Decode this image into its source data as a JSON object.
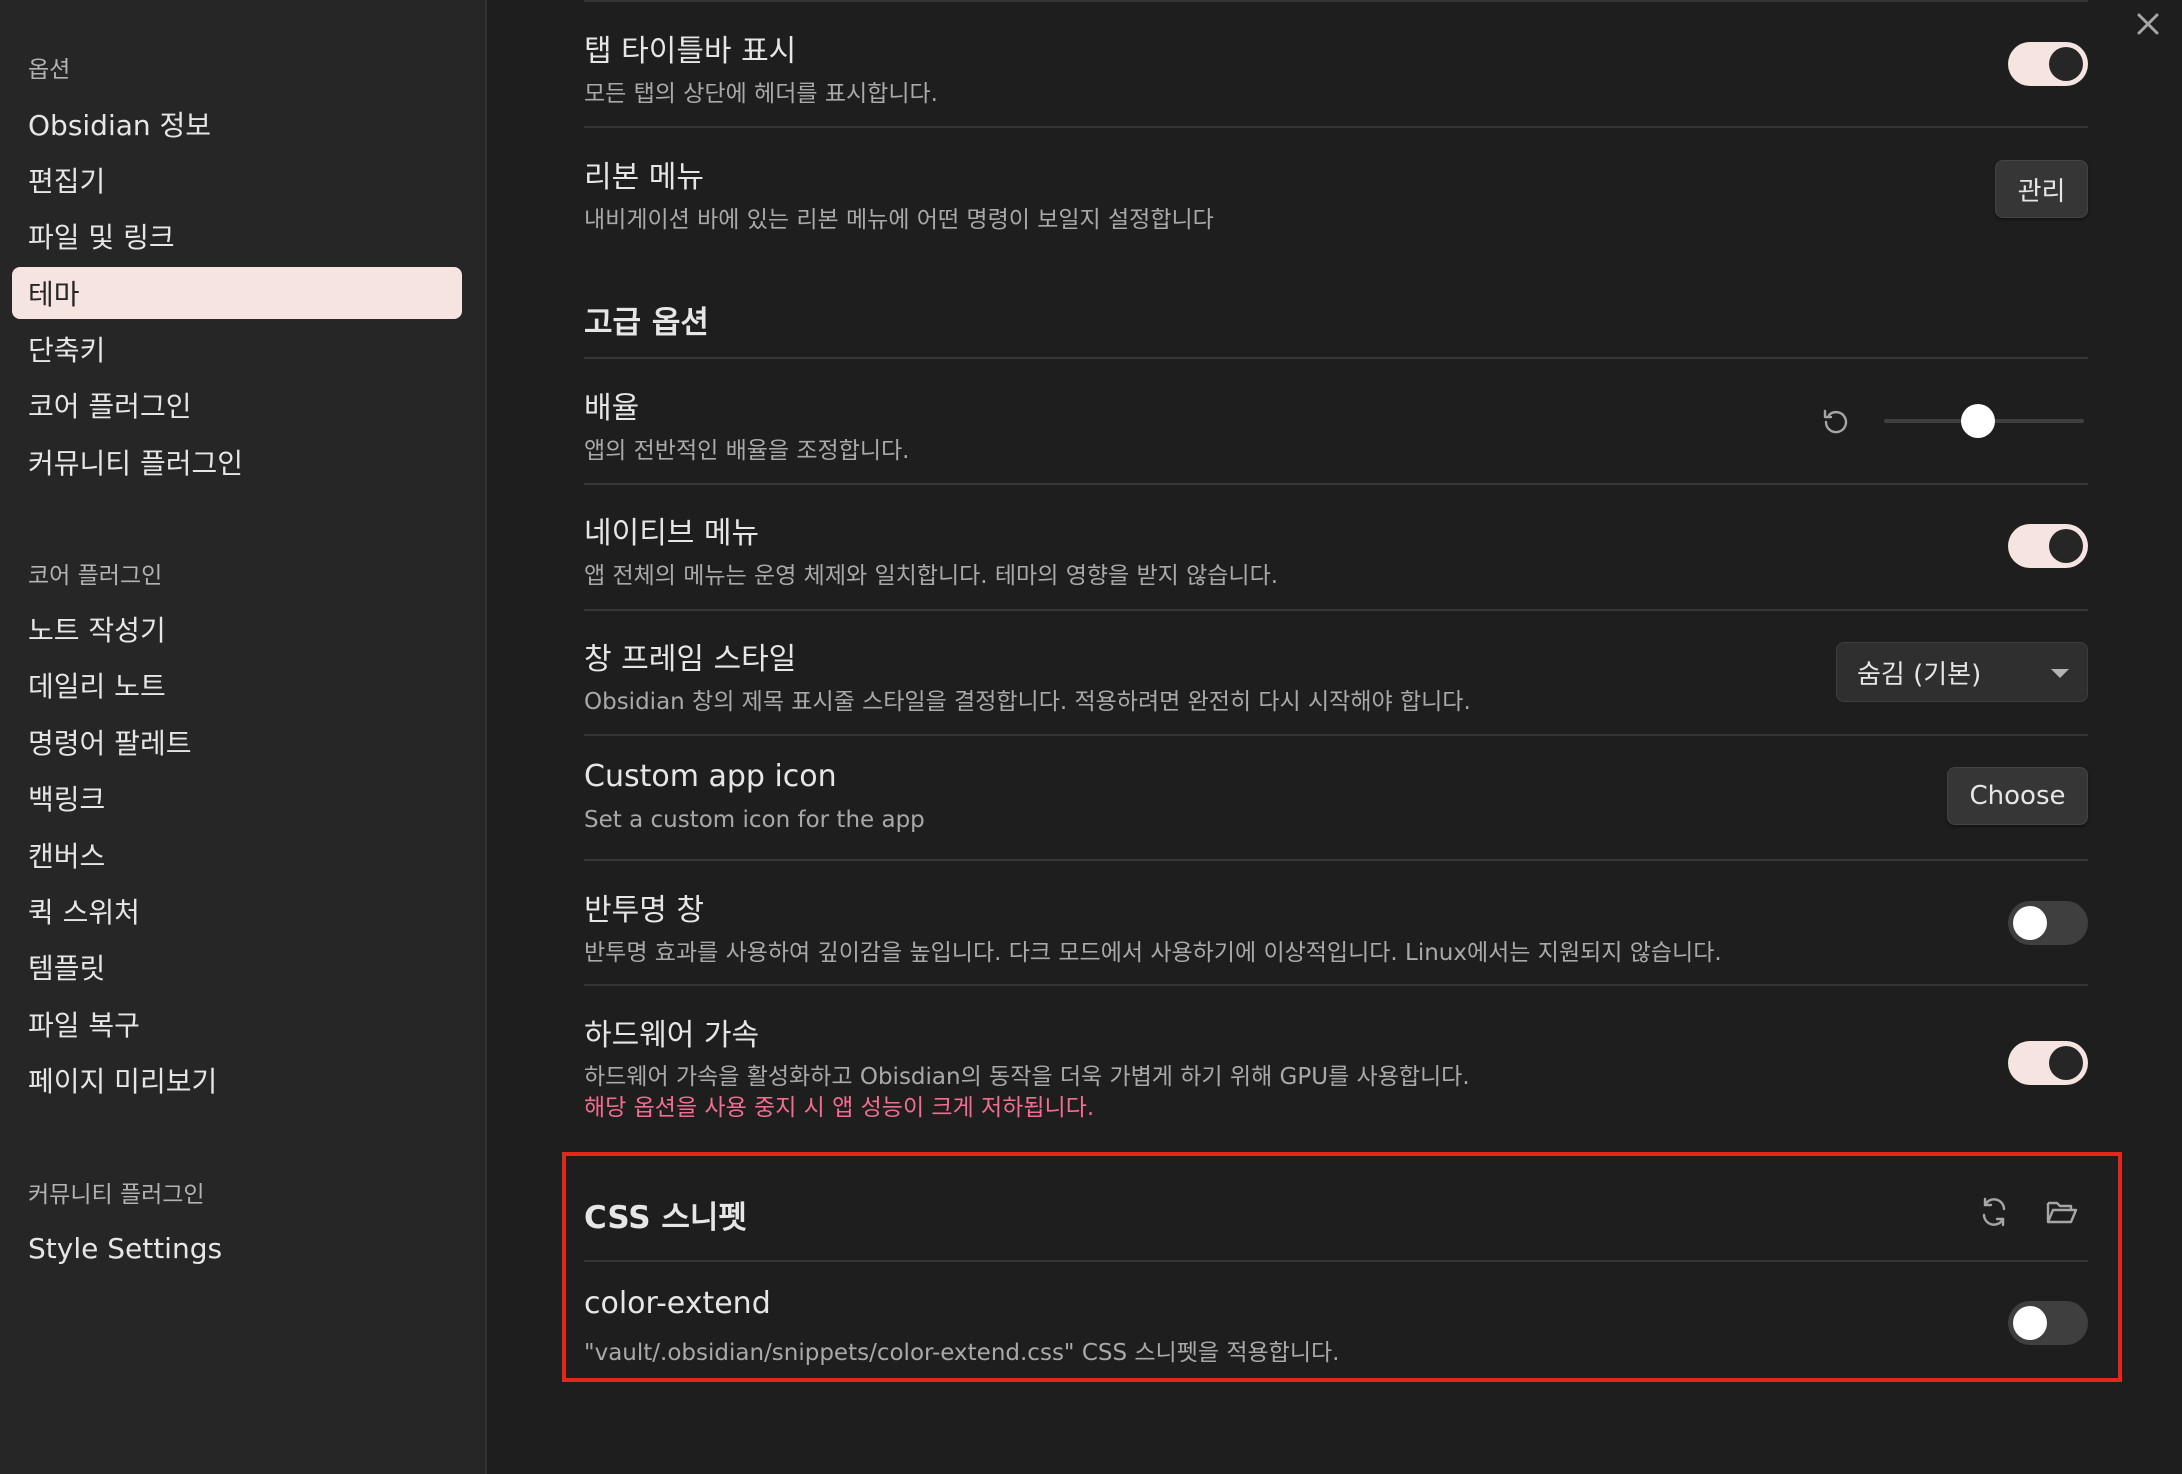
{
  "sidebar": {
    "groups": [
      {
        "header": "옵션",
        "items": [
          {
            "label": "Obsidian 정보"
          },
          {
            "label": "편집기"
          },
          {
            "label": "파일 및 링크"
          },
          {
            "label": "테마",
            "active": true
          },
          {
            "label": "단축키"
          },
          {
            "label": "코어 플러그인"
          },
          {
            "label": "커뮤니티 플러그인"
          }
        ]
      },
      {
        "header": "코어 플러그인",
        "items": [
          {
            "label": "노트 작성기"
          },
          {
            "label": "데일리 노트"
          },
          {
            "label": "명령어 팔레트"
          },
          {
            "label": "백링크"
          },
          {
            "label": "캔버스"
          },
          {
            "label": "퀵 스위처"
          },
          {
            "label": "템플릿"
          },
          {
            "label": "파일 복구"
          },
          {
            "label": "페이지 미리보기"
          }
        ]
      },
      {
        "header": "커뮤니티 플러그인",
        "items": [
          {
            "label": "Style Settings"
          }
        ]
      }
    ]
  },
  "settings": {
    "tab_title_bar": {
      "title": "탭 타이틀바 표시",
      "desc": "모든 탭의 상단에 헤더를 표시합니다.",
      "enabled": true
    },
    "ribbon_menu": {
      "title": "리본 메뉴",
      "desc": "내비게이션 바에 있는 리본 메뉴에 어떤 명령이 보일지 설정합니다",
      "button": "관리"
    },
    "advanced_heading": "고급 옵션",
    "zoom": {
      "title": "배율",
      "desc": "앱의 전반적인 배율을 조정합니다.",
      "level": 0.47
    },
    "native_menu": {
      "title": "네이티브 메뉴",
      "desc": "앱 전체의 메뉴는 운영 체제와 일치합니다. 테마의 영향을 받지 않습니다.",
      "enabled": true
    },
    "frame_style": {
      "title": "창 프레임 스타일",
      "desc": "Obsidian 창의 제목 표시줄 스타일을 결정합니다. 적용하려면 완전히 다시 시작해야 합니다.",
      "selected": "숨김 (기본)"
    },
    "app_icon": {
      "title": "Custom app icon",
      "desc": "Set a custom icon for the app",
      "button": "Choose"
    },
    "translucent": {
      "title": "반투명 창",
      "desc": "반투명 효과를 사용하여 깊이감을 높입니다. 다크 모드에서 사용하기에 이상적입니다. Linux에서는 지원되지 않습니다.",
      "enabled": false
    },
    "hardware_accel": {
      "title": "하드웨어 가속",
      "desc": "하드웨어 가속을 활성화하고 Obisdian의 동작을 더욱 가볍게 하기 위해 GPU를 사용합니다.",
      "warning": "해당 옵션을 사용 중지 시 앱 성능이 크게 저하됩니다.",
      "enabled": true
    },
    "css_snippets": {
      "heading": "CSS 스니펫",
      "items": [
        {
          "title": "color-extend",
          "desc": "\"vault/.obsidian/snippets/color-extend.css\" CSS 스니펫을 적용합니다.",
          "enabled": false
        }
      ]
    }
  },
  "icons": {
    "close": "close-icon",
    "reset": "reset-icon",
    "reload": "reload-icon",
    "folder": "folder-icon"
  },
  "colors": {
    "accent": "#f5e4e0",
    "highlight": "#e0281b",
    "warning": "#f26d8f"
  }
}
